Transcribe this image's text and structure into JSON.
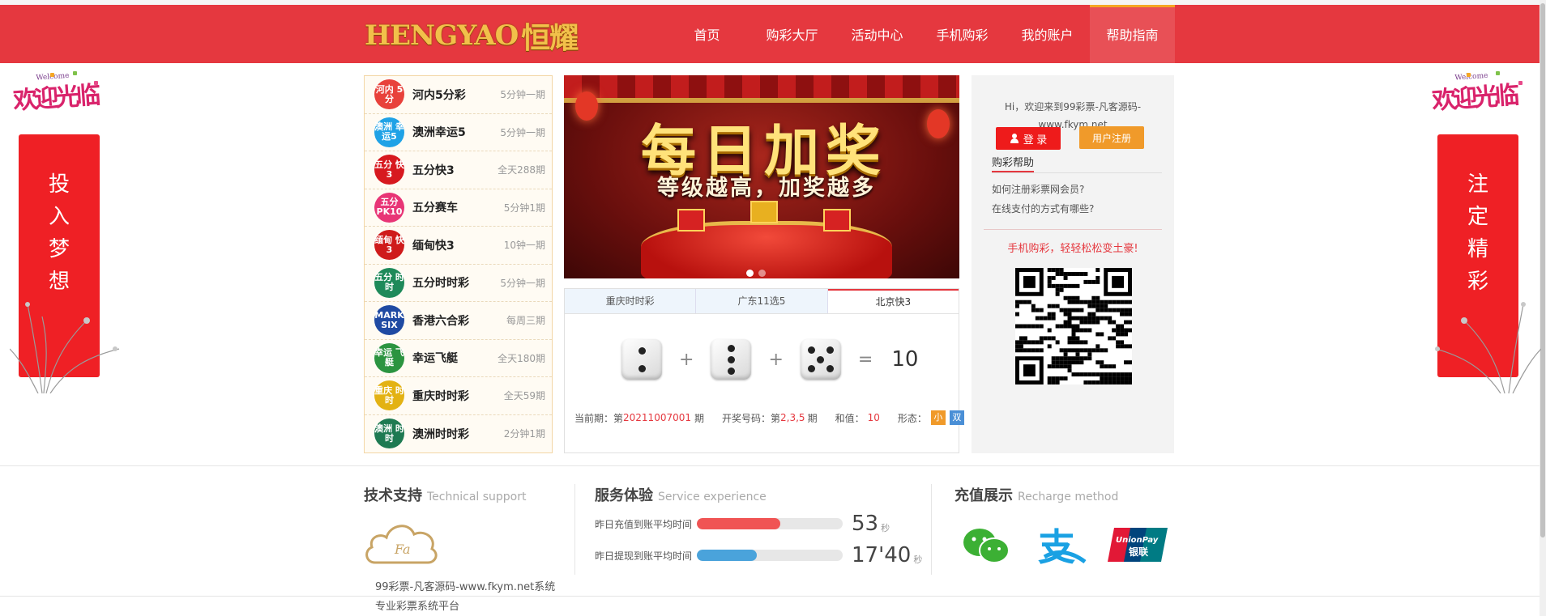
{
  "header": {
    "logo_text": "HENGYAO",
    "logo_cn": "恒耀",
    "nav": [
      {
        "label": "首页"
      },
      {
        "label": "购彩大厅"
      },
      {
        "label": "活动中心"
      },
      {
        "label": "手机购彩"
      },
      {
        "label": "我的账户"
      },
      {
        "label": "帮助指南",
        "active": true
      }
    ]
  },
  "side_left": {
    "welcome": "欢迎光临",
    "welcome_en": "Welcome",
    "banner": [
      "投",
      "入",
      "梦",
      "想"
    ]
  },
  "side_right": {
    "welcome": "欢迎光临",
    "welcome_en": "Welcome",
    "banner": [
      "注",
      "定",
      "精",
      "彩"
    ]
  },
  "lotteries": [
    {
      "name": "河内5分彩",
      "freq": "5分钟一期",
      "icon": "河内 5分",
      "color": "#e8413b"
    },
    {
      "name": "澳洲幸运5",
      "freq": "5分钟一期",
      "icon": "澳洲 幸运5",
      "color": "#1fa2e6"
    },
    {
      "name": "五分快3",
      "freq": "全天288期",
      "icon": "五分 快3",
      "color": "#d7191f"
    },
    {
      "name": "五分赛车",
      "freq": "5分钟1期",
      "icon": "五分 PK10",
      "color": "#e83576"
    },
    {
      "name": "缅甸快3",
      "freq": "10钟一期",
      "icon": "缅甸 快3",
      "color": "#cf1b1b"
    },
    {
      "name": "五分时时彩",
      "freq": "5分钟一期",
      "icon": "五分 时时",
      "color": "#1e8a5a"
    },
    {
      "name": "香港六合彩",
      "freq": "每周三期",
      "icon": "MARK SIX",
      "color": "#1f4aa3"
    },
    {
      "name": "幸运飞艇",
      "freq": "全天180期",
      "icon": "幸运 飞艇",
      "color": "#2b9440"
    },
    {
      "name": "重庆时时彩",
      "freq": "全天59期",
      "icon": "重庆 时时",
      "color": "#e3b213"
    },
    {
      "name": "澳洲时时彩",
      "freq": "2分钟1期",
      "icon": "澳洲 时时",
      "color": "#1e7a52"
    }
  ],
  "promo": {
    "title": "每日加奖",
    "subtitle": "等级越高，加奖越多"
  },
  "draw": {
    "tabs": [
      {
        "label": "重庆时时彩"
      },
      {
        "label": "广东11选5"
      },
      {
        "label": "北京快3",
        "active": true
      }
    ],
    "dice": [
      2,
      3,
      5
    ],
    "plus": "+",
    "equals": "=",
    "sum": "10",
    "period_label": "当前期：第",
    "period": "20211007001",
    "period_suffix": "期",
    "numbers_label": "开奖号码：第",
    "numbers": "2,3,5",
    "sum_label": "和值：",
    "sum_value": "10",
    "shape_label": "形态：",
    "shape_tags": [
      {
        "text": "小",
        "color": "#f09a2a"
      },
      {
        "text": "双",
        "color": "#4a8fd6"
      }
    ]
  },
  "member": {
    "greeting_1": "Hi，欢迎来到99彩票-凡客源码-",
    "greeting_2": "www.fkym.net",
    "login": "登 录",
    "register": "用户注册",
    "help_title": "购彩帮助",
    "help_questions": [
      "如何注册彩票网会员?",
      "在线支付的方式有哪些?"
    ],
    "mobile_tip": "手机购彩，轻轻松松变土豪!"
  },
  "footer": {
    "tech_title": "技术支持",
    "tech_en": "Technical support",
    "cloud_text": "Fa",
    "tech_line1": "99彩票-凡客源码-www.fkym.net系统",
    "tech_line2": "专业彩票系统平台",
    "service_title": "服务体验",
    "service_en": "Service experience",
    "service_rows": [
      {
        "label": "昨日充值到账平均时间",
        "value": "53",
        "unit": "秒",
        "fill": 0.57,
        "color": "#f05454"
      },
      {
        "label": "昨日提现到账平均时间",
        "value": "17'40",
        "unit": "秒",
        "fill": 0.41,
        "color": "#4aa3db"
      }
    ],
    "recharge_title": "充值展示",
    "recharge_en": "Recharge method",
    "unionpay_text": "UnionPay",
    "unionpay_cn": "银联",
    "alipay_char": "支"
  }
}
